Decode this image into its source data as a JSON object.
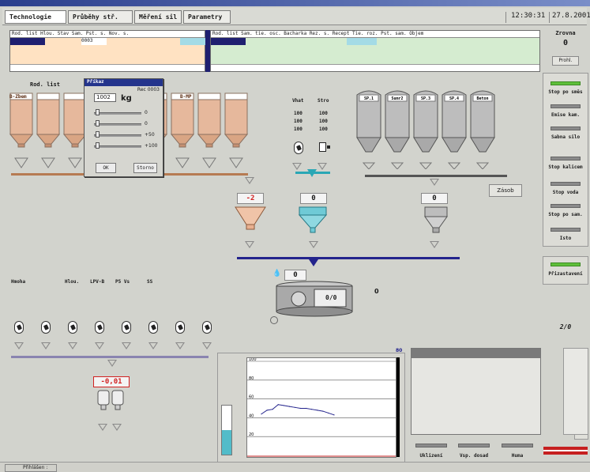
{
  "header": {
    "tabs": [
      "Technologie",
      "Průběhy stř.",
      "Měření sil",
      "Parametry"
    ],
    "time": "12:30:31",
    "date": "27.8.2001"
  },
  "left_table": {
    "columns": "Rod. list Hlou. Stav Sam. Pst. s. Nov. s.",
    "row_value": "0003"
  },
  "right_table": {
    "columns": "Rod. list Sam. tie. osc. Bacharka Rez. s. Recept Tie. roz. Pst. sam. Objem"
  },
  "right_panel": {
    "counter_label": "Zrovna",
    "counter_value": "0",
    "counter_btn": "Prohl.",
    "items": [
      "Stop po směs",
      "Emise kam.",
      "Sabna silo",
      "Stop kalicem",
      "Stop voda",
      "Stop po sam.",
      "Isto"
    ],
    "bottom_label": "Přizastavení",
    "num": "2/0"
  },
  "dialog": {
    "title": "Příkaz",
    "subtitle": "Rec 0003",
    "value": "1002",
    "unit": "kg",
    "scale_values": [
      "0",
      "0",
      "+50",
      "+100"
    ],
    "ok": "OK",
    "cancel": "Storno"
  },
  "silos_left": {
    "label": "Rod. list",
    "count": 9,
    "first": {
      "name": "B-Zbem",
      "vals": [
        "0",
        "0",
        "0,00",
        "0,000"
      ]
    },
    "last": {
      "name": "B-MP",
      "vals": [
        "0",
        "0",
        "0,00",
        "0"
      ]
    }
  },
  "mid": {
    "col1": "Vhat",
    "col2": "Stro",
    "row_a": [
      "100",
      "100"
    ],
    "row_b": [
      "100",
      "100"
    ],
    "row_c": [
      "100",
      "100"
    ],
    "water_val": "0",
    "hopper_val": "-2"
  },
  "silos_right": {
    "names": [
      "SP.1",
      "Sumr2",
      "SP.3",
      "SP.4",
      "Beton"
    ],
    "button": "Zásob",
    "val": "0"
  },
  "mixer": {
    "val1": "0",
    "val2": "0/0",
    "val3": "0"
  },
  "additives": {
    "labels": [
      "Hmoha",
      "Hlou.",
      "LPV-B",
      "P5 Vs",
      "SS"
    ],
    "value": "-0,01"
  },
  "chart_data": {
    "type": "line",
    "title": "",
    "xlabel": "",
    "ylabel": "",
    "y_ticks": [
      "100",
      "80",
      "60",
      "40",
      "20"
    ],
    "ylim": [
      0,
      100
    ],
    "bar_value": 50,
    "series": [
      {
        "values": [
          44,
          48,
          49,
          54,
          53,
          52,
          51,
          50,
          50,
          49,
          48,
          47,
          45,
          43
        ]
      }
    ],
    "top_value": "80"
  },
  "bottom_buttons": [
    "Uklizení",
    "Vsp. dosad",
    "Huma"
  ],
  "statusbar": {
    "text": "Přihlášen :"
  },
  "colors": {
    "accent": "#24348c",
    "copper": "#c59072",
    "cyan": "#2aa7b5",
    "green": "#5fbf3a"
  }
}
